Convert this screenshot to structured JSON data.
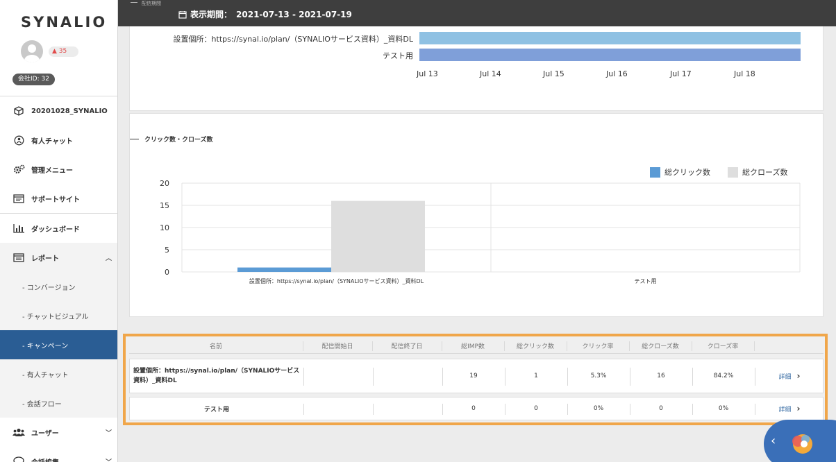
{
  "brand": {
    "logo": "SYNALIO"
  },
  "user": {
    "notification_count": "35",
    "company_id": "会社ID: 32"
  },
  "sidebar": {
    "items": [
      {
        "label": "20201028_SYNALIO"
      },
      {
        "label": "有人チャット"
      },
      {
        "label": "管理メニュー"
      },
      {
        "label": "サポートサイト"
      },
      {
        "label": "ダッシュボード"
      },
      {
        "label": "レポート"
      },
      {
        "label": "ユーザー"
      },
      {
        "label": "会話編集"
      }
    ],
    "report_sub": [
      {
        "label": "- コンバージョン"
      },
      {
        "label": "- チャットビジュアル"
      },
      {
        "label": "- キャンペーン"
      },
      {
        "label": "- 有人チャット"
      },
      {
        "label": "- 会話フロー"
      }
    ]
  },
  "topbar": {
    "section_label": "配信期間",
    "period_label": "表示期間：",
    "period_value": "2021-07-13 - 2021-07-19"
  },
  "gantt": {
    "rows": [
      {
        "label": "設置個所：https://synal.io/plan/（SYNALIOサービス資料）_資料DL",
        "color": "#8fc1e3"
      },
      {
        "label": "テスト用",
        "color": "#7f9fd9"
      }
    ],
    "ticks": [
      "Jul 13",
      "Jul 14",
      "Jul 15",
      "Jul 16",
      "Jul 17",
      "Jul 18"
    ]
  },
  "click_section": {
    "title": "クリック数・クローズ数"
  },
  "chart_data": {
    "type": "bar",
    "categories": [
      "設置個所：https://synal.io/plan/（SYNALIOサービス資料）_資料DL",
      "テスト用"
    ],
    "series": [
      {
        "name": "総クリック数",
        "values": [
          1,
          0
        ],
        "color": "#5b9bd5"
      },
      {
        "name": "総クローズ数",
        "values": [
          16,
          0
        ],
        "color": "#dedede"
      }
    ],
    "ylim": [
      0,
      20
    ],
    "yticks": [
      "0",
      "5",
      "10",
      "15",
      "20"
    ],
    "legend": "top-right",
    "grid": true
  },
  "table": {
    "headers": [
      "名前",
      "配信開始日",
      "配信終了日",
      "総IMP数",
      "総クリック数",
      "クリック率",
      "総クローズ数",
      "クローズ率",
      ""
    ],
    "rows": [
      {
        "name": "設置個所：https://synal.io/plan/（SYNALIOサービス資料）_資料DL",
        "start": "",
        "end": "",
        "imp": "19",
        "clicks": "1",
        "ctr": "5.3%",
        "closes": "16",
        "close_rate": "84.2%",
        "detail": "詳細"
      },
      {
        "name": "テスト用",
        "start": "",
        "end": "",
        "imp": "0",
        "clicks": "0",
        "ctr": "0%",
        "closes": "0",
        "close_rate": "0%",
        "detail": "詳細"
      }
    ]
  }
}
